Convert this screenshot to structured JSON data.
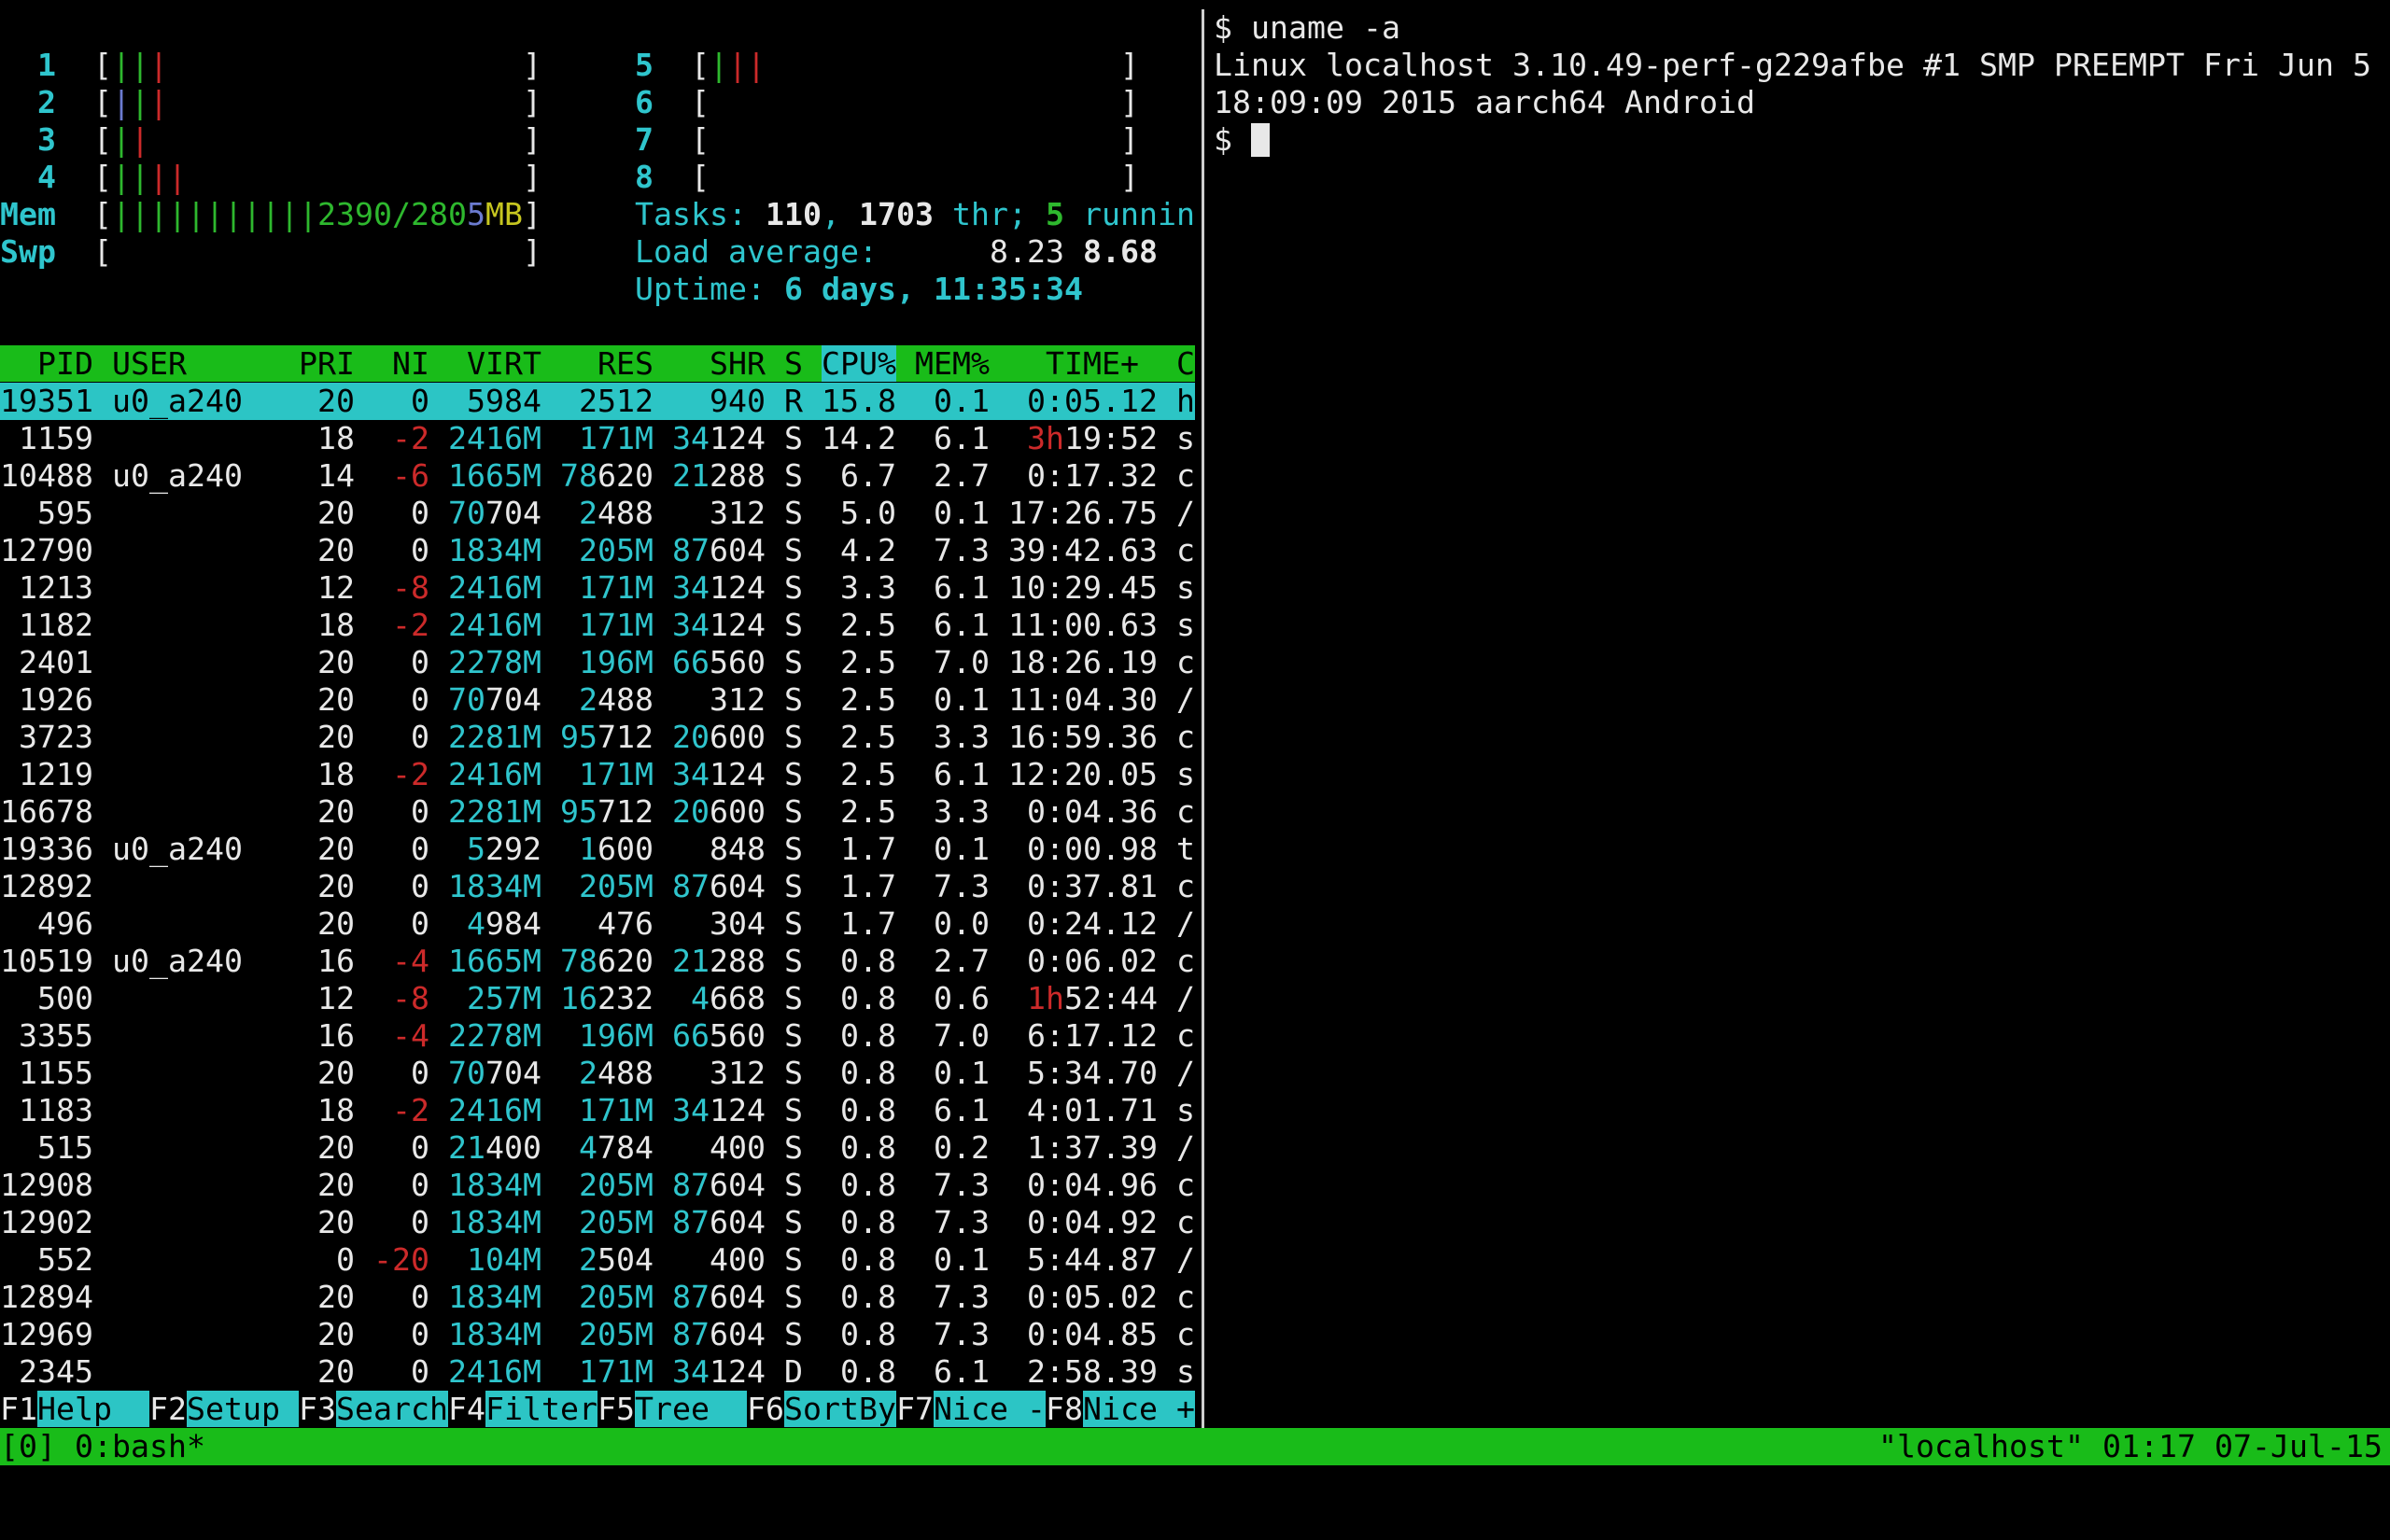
{
  "app": "tmux session: htop (left pane) + shell (right pane)",
  "colors": {
    "background": "#000000",
    "cyan_text": "#2fc5cd",
    "green_text": "#2eb82e",
    "red_text": "#cc2a2a",
    "blue_text": "#6b7bd0",
    "yellow_text": "#c6c620",
    "white_text": "#e8e8e8",
    "header_green_bg": "#19bc19",
    "selection_cyan_bg": "#2cc5c5",
    "status_green_bg": "#19bc19",
    "divider": "#cfcfcf"
  },
  "htop": {
    "cpu_meters_left": [
      {
        "label": "1",
        "bars": [
          [
            "green",
            2
          ],
          [
            "red",
            1
          ]
        ]
      },
      {
        "label": "2",
        "bars": [
          [
            "blue",
            1
          ],
          [
            "green",
            1
          ],
          [
            "red",
            1
          ]
        ]
      },
      {
        "label": "3",
        "bars": [
          [
            "green",
            1
          ],
          [
            "red",
            1
          ]
        ]
      },
      {
        "label": "4",
        "bars": [
          [
            "green",
            2
          ],
          [
            "red",
            2
          ]
        ]
      }
    ],
    "cpu_meters_right": [
      {
        "label": "5",
        "bars": [
          [
            "green",
            1
          ],
          [
            "red",
            2
          ]
        ]
      },
      {
        "label": "6",
        "bars": []
      },
      {
        "label": "7",
        "bars": []
      },
      {
        "label": "8",
        "bars": []
      }
    ],
    "mem_meter": {
      "label": "Mem",
      "green_bars": 11,
      "text": [
        {
          "t": "2390/280",
          "c": "green"
        },
        {
          "t": "5",
          "c": "blue"
        },
        {
          "t": "MB",
          "c": "yellow"
        }
      ]
    },
    "swp_meter": {
      "label": "Swp",
      "green_bars": 0,
      "text": []
    },
    "tasks_line": [
      {
        "t": "Tasks: ",
        "c": "cyan"
      },
      {
        "t": "110",
        "c": "white_b"
      },
      {
        "t": ", ",
        "c": "cyan"
      },
      {
        "t": "1703",
        "c": "white_b"
      },
      {
        "t": " thr; ",
        "c": "cyan"
      },
      {
        "t": "5",
        "c": "green_b"
      },
      {
        "t": " runnin",
        "c": "cyan"
      }
    ],
    "load_line": [
      {
        "t": "Load average: ",
        "c": "cyan"
      },
      {
        "t": "     ",
        "c": "white"
      },
      {
        "t": "8.23",
        "c": "white"
      },
      {
        "t": " ",
        "c": "white"
      },
      {
        "t": "8.68",
        "c": "white_b"
      }
    ],
    "uptime_line": [
      {
        "t": "Uptime: ",
        "c": "cyan"
      },
      {
        "t": "6 days, 11:35:34",
        "c": "cyan_b"
      }
    ],
    "table": {
      "header": {
        "pre": "  PID USER      PRI  NI  VIRT   RES   SHR S ",
        "sort": "CPU%",
        "post": " MEM%   TIME+  C"
      },
      "columns": [
        "PID",
        "USER",
        "PRI",
        "NI",
        "VIRT",
        "RES",
        "SHR",
        "S",
        "CPU%",
        "MEM%",
        "TIME+",
        "Command"
      ],
      "rows": [
        {
          "pid": "19351",
          "user": "u0_a240",
          "pri": "20",
          "ni": "0",
          "virt": "5984",
          "res": "2512",
          "shr": "940",
          "s": "R",
          "cpu": "15.8",
          "mem": "0.1",
          "time": "0:05.12",
          "cmd": "h",
          "selected": true
        },
        {
          "pid": "1159",
          "user": "",
          "pri": "18",
          "ni": "-2",
          "virt": "2416M",
          "res": "171M",
          "shr": "34124",
          "s": "S",
          "cpu": "14.2",
          "mem": "6.1",
          "time": "3h19:52",
          "cmd": "s"
        },
        {
          "pid": "10488",
          "user": "u0_a240",
          "pri": "14",
          "ni": "-6",
          "virt": "1665M",
          "res": "78620",
          "shr": "21288",
          "s": "S",
          "cpu": "6.7",
          "mem": "2.7",
          "time": "0:17.32",
          "cmd": "c"
        },
        {
          "pid": "595",
          "user": "",
          "pri": "20",
          "ni": "0",
          "virt": "70704",
          "res": "2488",
          "shr": "312",
          "s": "S",
          "cpu": "5.0",
          "mem": "0.1",
          "time": "17:26.75",
          "cmd": "/"
        },
        {
          "pid": "12790",
          "user": "",
          "pri": "20",
          "ni": "0",
          "virt": "1834M",
          "res": "205M",
          "shr": "87604",
          "s": "S",
          "cpu": "4.2",
          "mem": "7.3",
          "time": "39:42.63",
          "cmd": "c"
        },
        {
          "pid": "1213",
          "user": "",
          "pri": "12",
          "ni": "-8",
          "virt": "2416M",
          "res": "171M",
          "shr": "34124",
          "s": "S",
          "cpu": "3.3",
          "mem": "6.1",
          "time": "10:29.45",
          "cmd": "s"
        },
        {
          "pid": "1182",
          "user": "",
          "pri": "18",
          "ni": "-2",
          "virt": "2416M",
          "res": "171M",
          "shr": "34124",
          "s": "S",
          "cpu": "2.5",
          "mem": "6.1",
          "time": "11:00.63",
          "cmd": "s"
        },
        {
          "pid": "2401",
          "user": "",
          "pri": "20",
          "ni": "0",
          "virt": "2278M",
          "res": "196M",
          "shr": "66560",
          "s": "S",
          "cpu": "2.5",
          "mem": "7.0",
          "time": "18:26.19",
          "cmd": "c"
        },
        {
          "pid": "1926",
          "user": "",
          "pri": "20",
          "ni": "0",
          "virt": "70704",
          "res": "2488",
          "shr": "312",
          "s": "S",
          "cpu": "2.5",
          "mem": "0.1",
          "time": "11:04.30",
          "cmd": "/"
        },
        {
          "pid": "3723",
          "user": "",
          "pri": "20",
          "ni": "0",
          "virt": "2281M",
          "res": "95712",
          "shr": "20600",
          "s": "S",
          "cpu": "2.5",
          "mem": "3.3",
          "time": "16:59.36",
          "cmd": "c"
        },
        {
          "pid": "1219",
          "user": "",
          "pri": "18",
          "ni": "-2",
          "virt": "2416M",
          "res": "171M",
          "shr": "34124",
          "s": "S",
          "cpu": "2.5",
          "mem": "6.1",
          "time": "12:20.05",
          "cmd": "s"
        },
        {
          "pid": "16678",
          "user": "",
          "pri": "20",
          "ni": "0",
          "virt": "2281M",
          "res": "95712",
          "shr": "20600",
          "s": "S",
          "cpu": "2.5",
          "mem": "3.3",
          "time": "0:04.36",
          "cmd": "c"
        },
        {
          "pid": "19336",
          "user": "u0_a240",
          "pri": "20",
          "ni": "0",
          "virt": "5292",
          "res": "1600",
          "shr": "848",
          "s": "S",
          "cpu": "1.7",
          "mem": "0.1",
          "time": "0:00.98",
          "cmd": "t"
        },
        {
          "pid": "12892",
          "user": "",
          "pri": "20",
          "ni": "0",
          "virt": "1834M",
          "res": "205M",
          "shr": "87604",
          "s": "S",
          "cpu": "1.7",
          "mem": "7.3",
          "time": "0:37.81",
          "cmd": "c"
        },
        {
          "pid": "496",
          "user": "",
          "pri": "20",
          "ni": "0",
          "virt": "4984",
          "res": "476",
          "shr": "304",
          "s": "S",
          "cpu": "1.7",
          "mem": "0.0",
          "time": "0:24.12",
          "cmd": "/"
        },
        {
          "pid": "10519",
          "user": "u0_a240",
          "pri": "16",
          "ni": "-4",
          "virt": "1665M",
          "res": "78620",
          "shr": "21288",
          "s": "S",
          "cpu": "0.8",
          "mem": "2.7",
          "time": "0:06.02",
          "cmd": "c"
        },
        {
          "pid": "500",
          "user": "",
          "pri": "12",
          "ni": "-8",
          "virt": "257M",
          "res": "16232",
          "shr": "4668",
          "s": "S",
          "cpu": "0.8",
          "mem": "0.6",
          "time": "1h52:44",
          "cmd": "/"
        },
        {
          "pid": "3355",
          "user": "",
          "pri": "16",
          "ni": "-4",
          "virt": "2278M",
          "res": "196M",
          "shr": "66560",
          "s": "S",
          "cpu": "0.8",
          "mem": "7.0",
          "time": "6:17.12",
          "cmd": "c"
        },
        {
          "pid": "1155",
          "user": "",
          "pri": "20",
          "ni": "0",
          "virt": "70704",
          "res": "2488",
          "shr": "312",
          "s": "S",
          "cpu": "0.8",
          "mem": "0.1",
          "time": "5:34.70",
          "cmd": "/"
        },
        {
          "pid": "1183",
          "user": "",
          "pri": "18",
          "ni": "-2",
          "virt": "2416M",
          "res": "171M",
          "shr": "34124",
          "s": "S",
          "cpu": "0.8",
          "mem": "6.1",
          "time": "4:01.71",
          "cmd": "s"
        },
        {
          "pid": "515",
          "user": "",
          "pri": "20",
          "ni": "0",
          "virt": "21400",
          "res": "4784",
          "shr": "400",
          "s": "S",
          "cpu": "0.8",
          "mem": "0.2",
          "time": "1:37.39",
          "cmd": "/"
        },
        {
          "pid": "12908",
          "user": "",
          "pri": "20",
          "ni": "0",
          "virt": "1834M",
          "res": "205M",
          "shr": "87604",
          "s": "S",
          "cpu": "0.8",
          "mem": "7.3",
          "time": "0:04.96",
          "cmd": "c"
        },
        {
          "pid": "12902",
          "user": "",
          "pri": "20",
          "ni": "0",
          "virt": "1834M",
          "res": "205M",
          "shr": "87604",
          "s": "S",
          "cpu": "0.8",
          "mem": "7.3",
          "time": "0:04.92",
          "cmd": "c"
        },
        {
          "pid": "552",
          "user": "",
          "pri": "0",
          "ni": "-20",
          "virt": "104M",
          "res": "2504",
          "shr": "400",
          "s": "S",
          "cpu": "0.8",
          "mem": "0.1",
          "time": "5:44.87",
          "cmd": "/"
        },
        {
          "pid": "12894",
          "user": "",
          "pri": "20",
          "ni": "0",
          "virt": "1834M",
          "res": "205M",
          "shr": "87604",
          "s": "S",
          "cpu": "0.8",
          "mem": "7.3",
          "time": "0:05.02",
          "cmd": "c"
        },
        {
          "pid": "12969",
          "user": "",
          "pri": "20",
          "ni": "0",
          "virt": "1834M",
          "res": "205M",
          "shr": "87604",
          "s": "S",
          "cpu": "0.8",
          "mem": "7.3",
          "time": "0:04.85",
          "cmd": "c"
        },
        {
          "pid": "2345",
          "user": "",
          "pri": "20",
          "ni": "0",
          "virt": "2416M",
          "res": "171M",
          "shr": "34124",
          "s": "D",
          "cpu": "0.8",
          "mem": "6.1",
          "time": "2:58.39",
          "cmd": "s"
        }
      ]
    },
    "fn_bar": [
      {
        "key": "F1",
        "label": "Help  "
      },
      {
        "key": "F2",
        "label": "Setup "
      },
      {
        "key": "F3",
        "label": "Search"
      },
      {
        "key": "F4",
        "label": "Filter"
      },
      {
        "key": "F5",
        "label": "Tree  "
      },
      {
        "key": "F6",
        "label": "SortBy"
      },
      {
        "key": "F7",
        "label": "Nice -"
      },
      {
        "key": "F8",
        "label": "Nice +"
      }
    ]
  },
  "shell": {
    "lines": [
      "$ uname -a",
      "Linux localhost 3.10.49-perf-g229afbe #1 SMP PREEMPT Fri Jun 5",
      "18:09:09 2015 aarch64 Android",
      "$ "
    ],
    "cursor_visible": true
  },
  "tmux_status": {
    "left": "[0] 0:bash*",
    "right": "\"localhost\" 01:17 07-Jul-15"
  }
}
